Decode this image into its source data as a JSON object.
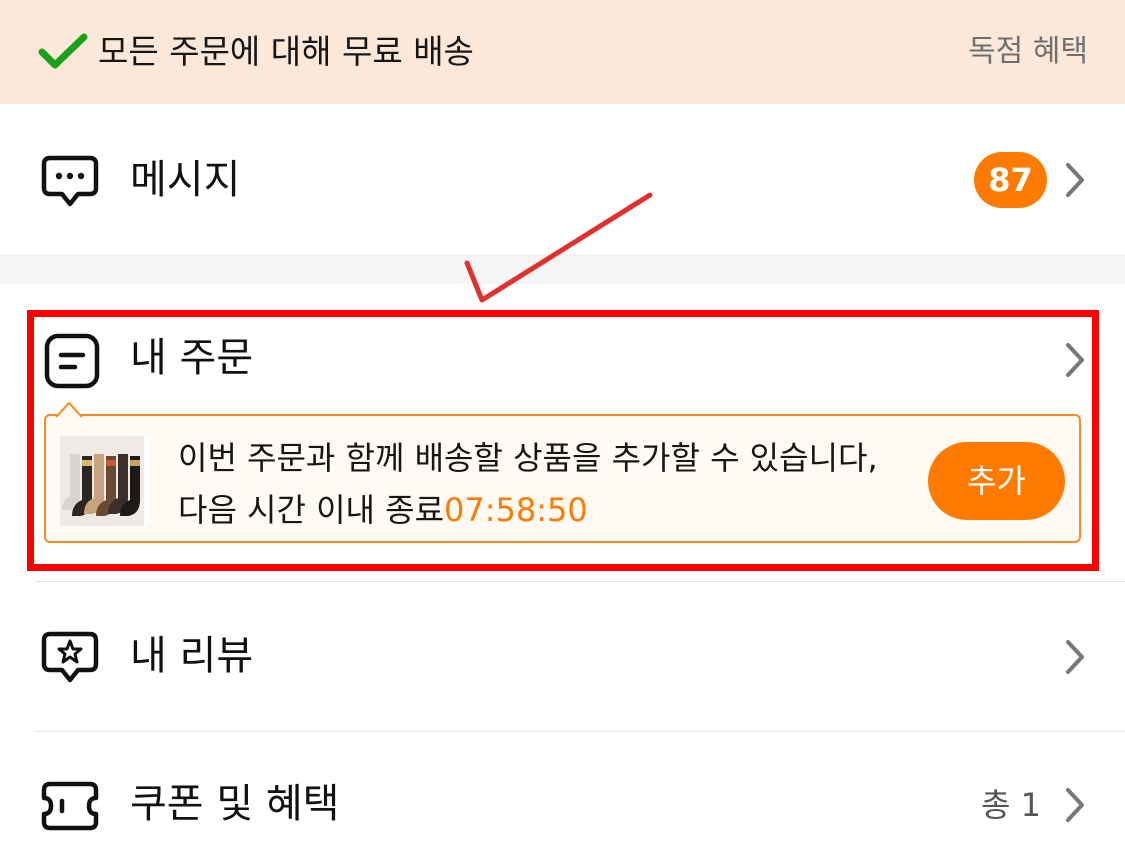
{
  "banner": {
    "text": "모든 주문에 대해 무료 배송",
    "link": "독점 혜택",
    "check_icon": "check-icon",
    "accent_color": "#1aa31a"
  },
  "messages": {
    "label": "메시지",
    "badge_count": "87",
    "icon": "chat-bubble-icon"
  },
  "orders": {
    "label": "내 주문",
    "icon": "order-list-icon",
    "callout": {
      "text": "이번 주문과 함께 배송할 상품을 추가할 수 있습니다, 다음 시간 이내 종료",
      "timer": "07:58:50",
      "button_label": "추가"
    }
  },
  "reviews": {
    "label": "내 리뷰",
    "icon": "star-bubble-icon"
  },
  "coupons": {
    "label": "쿠폰 및 혜택",
    "total": "총 1",
    "icon": "ticket-icon"
  },
  "colors": {
    "accent": "#ff7a00",
    "banner_bg": "#fce8d9",
    "highlight": "#ff0000"
  }
}
